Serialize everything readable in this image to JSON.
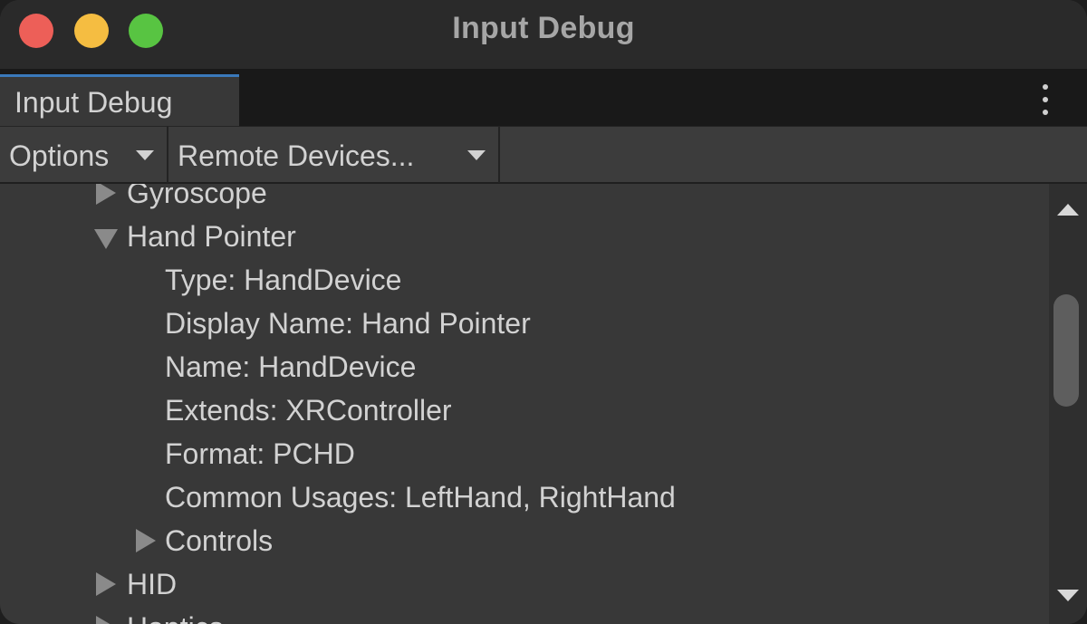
{
  "window": {
    "title": "Input Debug"
  },
  "tab": {
    "label": "Input Debug"
  },
  "toolbar": {
    "options_label": "Options",
    "remote_label": "Remote Devices..."
  },
  "tree": {
    "items": [
      {
        "label": "Gyroscope",
        "state": "collapsed"
      },
      {
        "label": "Hand Pointer",
        "state": "expanded"
      },
      {
        "label": "Type: HandDevice"
      },
      {
        "label": "Display Name: Hand Pointer"
      },
      {
        "label": "Name: HandDevice"
      },
      {
        "label": "Extends: XRController"
      },
      {
        "label": "Format: PCHD"
      },
      {
        "label": "Common Usages: LeftHand, RightHand"
      },
      {
        "label": "Controls",
        "state": "collapsed"
      },
      {
        "label": "HID",
        "state": "collapsed"
      },
      {
        "label": "Haptics",
        "state": "collapsed"
      }
    ]
  },
  "colors": {
    "tab_accent": "#3a79bb",
    "close": "#ed5f58",
    "minimize": "#f5bd41",
    "maximize": "#58c442"
  }
}
